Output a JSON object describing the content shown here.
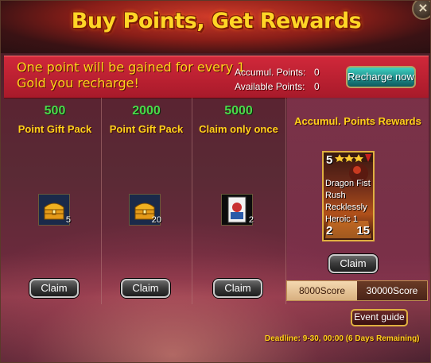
{
  "title": "Buy Points, Get Rewards",
  "close_glyph": "×",
  "banner": {
    "text": "One point will be gained for every 1 Gold you recharge!",
    "accumul_label": "Accumul. Points:",
    "accumul_value": "0",
    "available_label": "Available Points:",
    "available_value": "0",
    "recharge_label": "Recharge now"
  },
  "packs": [
    {
      "points": "500",
      "label": "Point Gift Pack",
      "item_icon": "gold-chest-icon",
      "count": "5",
      "claim_label": "Claim"
    },
    {
      "points": "2000",
      "label": "Point Gift Pack",
      "item_icon": "gold-chest-icon",
      "count": "20",
      "claim_label": "Claim"
    },
    {
      "points": "5000",
      "label": "Claim only once",
      "item_icon": "hero-card-icon",
      "count": "2",
      "claim_label": "Claim"
    }
  ],
  "rewards": {
    "title": "Accumul. Points Rewards",
    "card": {
      "top_left": "5",
      "name": "Dragon Fist Rush Recklessly Heroic 1",
      "bottom_left": "2",
      "bottom_right": "15"
    },
    "claim_label": "Claim",
    "tabs": [
      {
        "label": "8000Score",
        "active": true
      },
      {
        "label": "30000Score",
        "active": false
      }
    ]
  },
  "event_guide_label": "Event guide",
  "deadline": "Deadline: 9-30, 00:00 (6 Days Remaining)",
  "colors": {
    "title": "#ffd626",
    "banner_bg": "#c8283a",
    "points_green": "#4cd84a",
    "label_gold": "#ffd21a"
  }
}
